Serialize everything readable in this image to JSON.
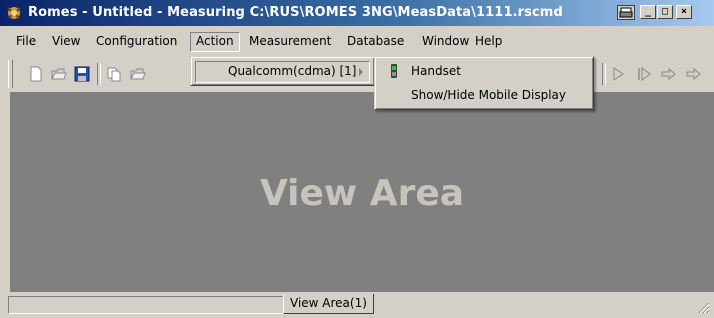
{
  "window": {
    "title": "Romes - Untitled - Measuring C:\\RUS\\ROMES 3NG\\MeasData\\1111.rscmd",
    "minimize_label": "_",
    "restore_label": "□",
    "close_label": "×",
    "accent_color": "#0a246a"
  },
  "menubar": {
    "items": [
      {
        "label": "File"
      },
      {
        "label": "View"
      },
      {
        "label": "Configuration"
      },
      {
        "label": "Action"
      },
      {
        "label": "Measurement"
      },
      {
        "label": "Database"
      },
      {
        "label": "Window"
      },
      {
        "label": "Help"
      }
    ],
    "open_item": "Action"
  },
  "action_menu": {
    "items": [
      {
        "label": "Qualcomm(cdma) [1]",
        "has_submenu": true
      }
    ]
  },
  "submenu": {
    "items": [
      {
        "label": "Handset",
        "icon": "handset-icon"
      },
      {
        "label": "Show/Hide Mobile Display"
      }
    ]
  },
  "view": {
    "label": "View Area"
  },
  "statusbar": {
    "tab_label": "View Area(1)"
  }
}
